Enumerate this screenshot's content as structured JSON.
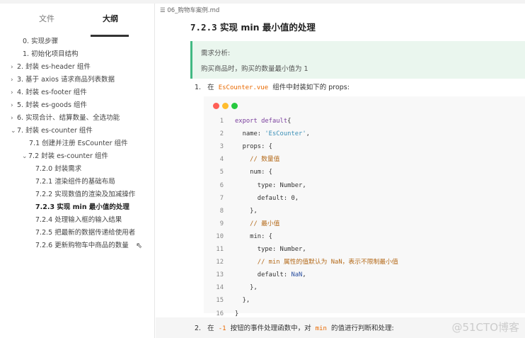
{
  "sidebar": {
    "tabs": [
      "文件",
      "大纲"
    ],
    "active_tab": "大纲",
    "outline": [
      {
        "label": "0. 实现步骤",
        "level": 0,
        "chevron": ""
      },
      {
        "label": "1. 初始化项目结构",
        "level": 0,
        "chevron": ""
      },
      {
        "label": "2. 封装 es-header 组件",
        "level": 0,
        "chevron": "›"
      },
      {
        "label": "3. 基于 axios 请求商品列表数据",
        "level": 0,
        "chevron": "›"
      },
      {
        "label": "4. 封装 es-footer 组件",
        "level": 0,
        "chevron": "›"
      },
      {
        "label": "5. 封装 es-goods 组件",
        "level": 0,
        "chevron": "›"
      },
      {
        "label": "6. 实现合计、结算数量、全选功能",
        "level": 0,
        "chevron": "›"
      },
      {
        "label": "7. 封装 es-counter 组件",
        "level": 0,
        "chevron": "⌄"
      },
      {
        "label": "7.1 创建并注册 EsCounter 组件",
        "level": 1,
        "chevron": ""
      },
      {
        "label": "7.2 封装 es-counter 组件",
        "level": 1,
        "chevron": "⌄"
      },
      {
        "label": "7.2.0 封装需求",
        "level": 2,
        "chevron": ""
      },
      {
        "label": "7.2.1 渲染组件的基础布局",
        "level": 2,
        "chevron": ""
      },
      {
        "label": "7.2.2 实现数值的渲染及加减操作",
        "level": 2,
        "chevron": ""
      },
      {
        "label": "7.2.3 实现 min 最小值的处理",
        "level": 2,
        "chevron": "",
        "active": true
      },
      {
        "label": "7.2.4 处理输入框的输入结果",
        "level": 2,
        "chevron": ""
      },
      {
        "label": "7.2.5 把最新的数据传递给使用者",
        "level": 2,
        "chevron": ""
      },
      {
        "label": "7.2.6 更新购物车中商品的数量",
        "level": 2,
        "chevron": ""
      }
    ]
  },
  "main": {
    "filename": "06_购物车案例.md",
    "heading_num": "7.2.3",
    "heading_text": "实现 min 最小值的处理",
    "quote_title": "需求分析:",
    "quote_body": "购买商品时，购买的数量最小值为 1",
    "step1": {
      "num": "1.",
      "pre": "在",
      "code": "EsCounter.vue",
      "post": "组件中封装如下的 props:"
    },
    "step2": {
      "num": "2.",
      "pre": "在",
      "code": "-1",
      "mid": "按钮的事件处理函数中，对",
      "code2": "min",
      "post": "的值进行判断和处理:"
    },
    "code_lines": [
      [
        [
          "kw",
          "export default"
        ],
        [
          "",
          "{"
        ]
      ],
      [
        [
          "",
          "  name: "
        ],
        [
          "str",
          "'EsCounter'"
        ],
        [
          "",
          ","
        ]
      ],
      [
        [
          "",
          "  props: {"
        ]
      ],
      [
        [
          "cm",
          "    // 数量值"
        ]
      ],
      [
        [
          "",
          "    num: {"
        ]
      ],
      [
        [
          "",
          "      type: Number,"
        ]
      ],
      [
        [
          "",
          "      default: 0,"
        ]
      ],
      [
        [
          "",
          "    },"
        ]
      ],
      [
        [
          "cm",
          "    // 最小值"
        ]
      ],
      [
        [
          "",
          "    min: {"
        ]
      ],
      [
        [
          "",
          "      type: Number,"
        ]
      ],
      [
        [
          "cm",
          "      // min 属性的值默认为 NaN，表示不限制最小值"
        ]
      ],
      [
        [
          "",
          "      default: "
        ],
        [
          "nan",
          "NaN"
        ],
        [
          "",
          ","
        ]
      ],
      [
        [
          "",
          "    },"
        ]
      ],
      [
        [
          "",
          "  },"
        ]
      ],
      [
        [
          "",
          "}"
        ]
      ]
    ],
    "watermark": "@51CTO博客"
  },
  "colors": {
    "accent": "#42b983",
    "quote_bg": "#eaf6ee",
    "dot_red": "#ff5f56",
    "dot_yellow": "#ffbd2e",
    "dot_green": "#27c93f"
  }
}
